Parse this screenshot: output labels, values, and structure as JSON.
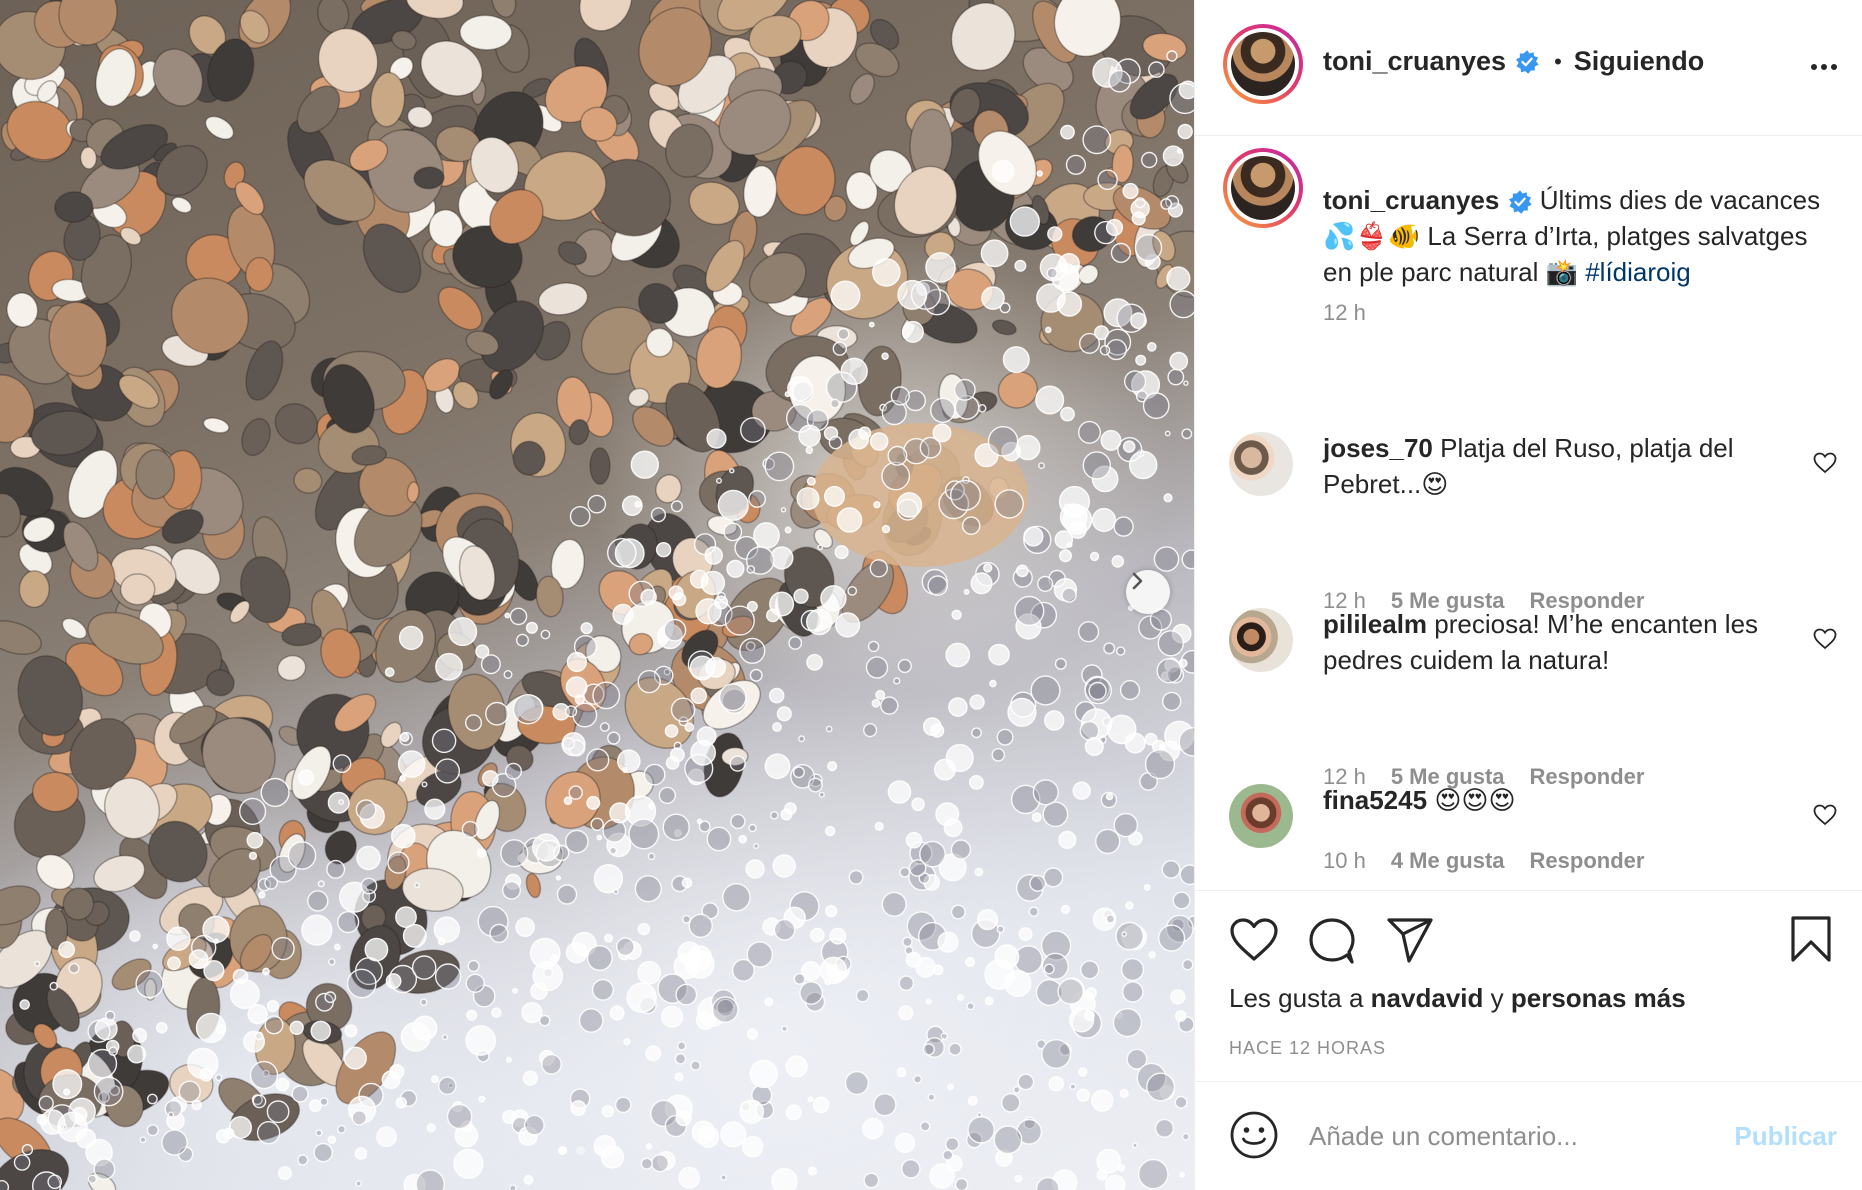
{
  "post": {
    "carousel": {
      "slide_count": 4,
      "active_slide": 0,
      "next_icon": "chevron-right-icon"
    },
    "author": {
      "username": "toni_cruanyes",
      "verified": true,
      "follow_status": "Siguiendo",
      "separator": "•"
    },
    "caption": {
      "username": "toni_cruanyes",
      "text": "Últims dies de vacances 💦👙🐠 La Serra d’Irta, platges salvatges en ple parc natural 📸",
      "hashtag": "#lídiaroig",
      "time": "12 h"
    },
    "comments": [
      {
        "username": "joses_70",
        "text": "Platja del Ruso, platja del Pebret...😍",
        "time": "12 h",
        "likes": "5 Me gusta",
        "reply": "Responder"
      },
      {
        "username": "pililealm",
        "text": "preciosa! M’he encanten les pedres cuidem la natura!",
        "time": "12 h",
        "likes": "5 Me gusta",
        "reply": "Responder"
      },
      {
        "username": "fina5245",
        "text": "😍😍😍",
        "time": "10 h",
        "likes": "4 Me gusta",
        "reply": "Responder"
      }
    ],
    "likes": {
      "prefix": "Les gusta a",
      "user": "navdavid",
      "conjunction": "y",
      "others": "personas más"
    },
    "posted_ago": "HACE 12 HORAS",
    "add_comment": {
      "placeholder": "Añade un comentario...",
      "publish_label": "Publicar"
    },
    "icons": [
      "more-icon",
      "verified-icon",
      "heart-icon",
      "comment-icon",
      "share-icon",
      "bookmark-icon",
      "emoji-icon"
    ],
    "colors": {
      "verified": "#3897f0",
      "hashtag": "#00376b",
      "muted": "#8e8e8e",
      "publish_disabled": "#b2dffc"
    }
  }
}
